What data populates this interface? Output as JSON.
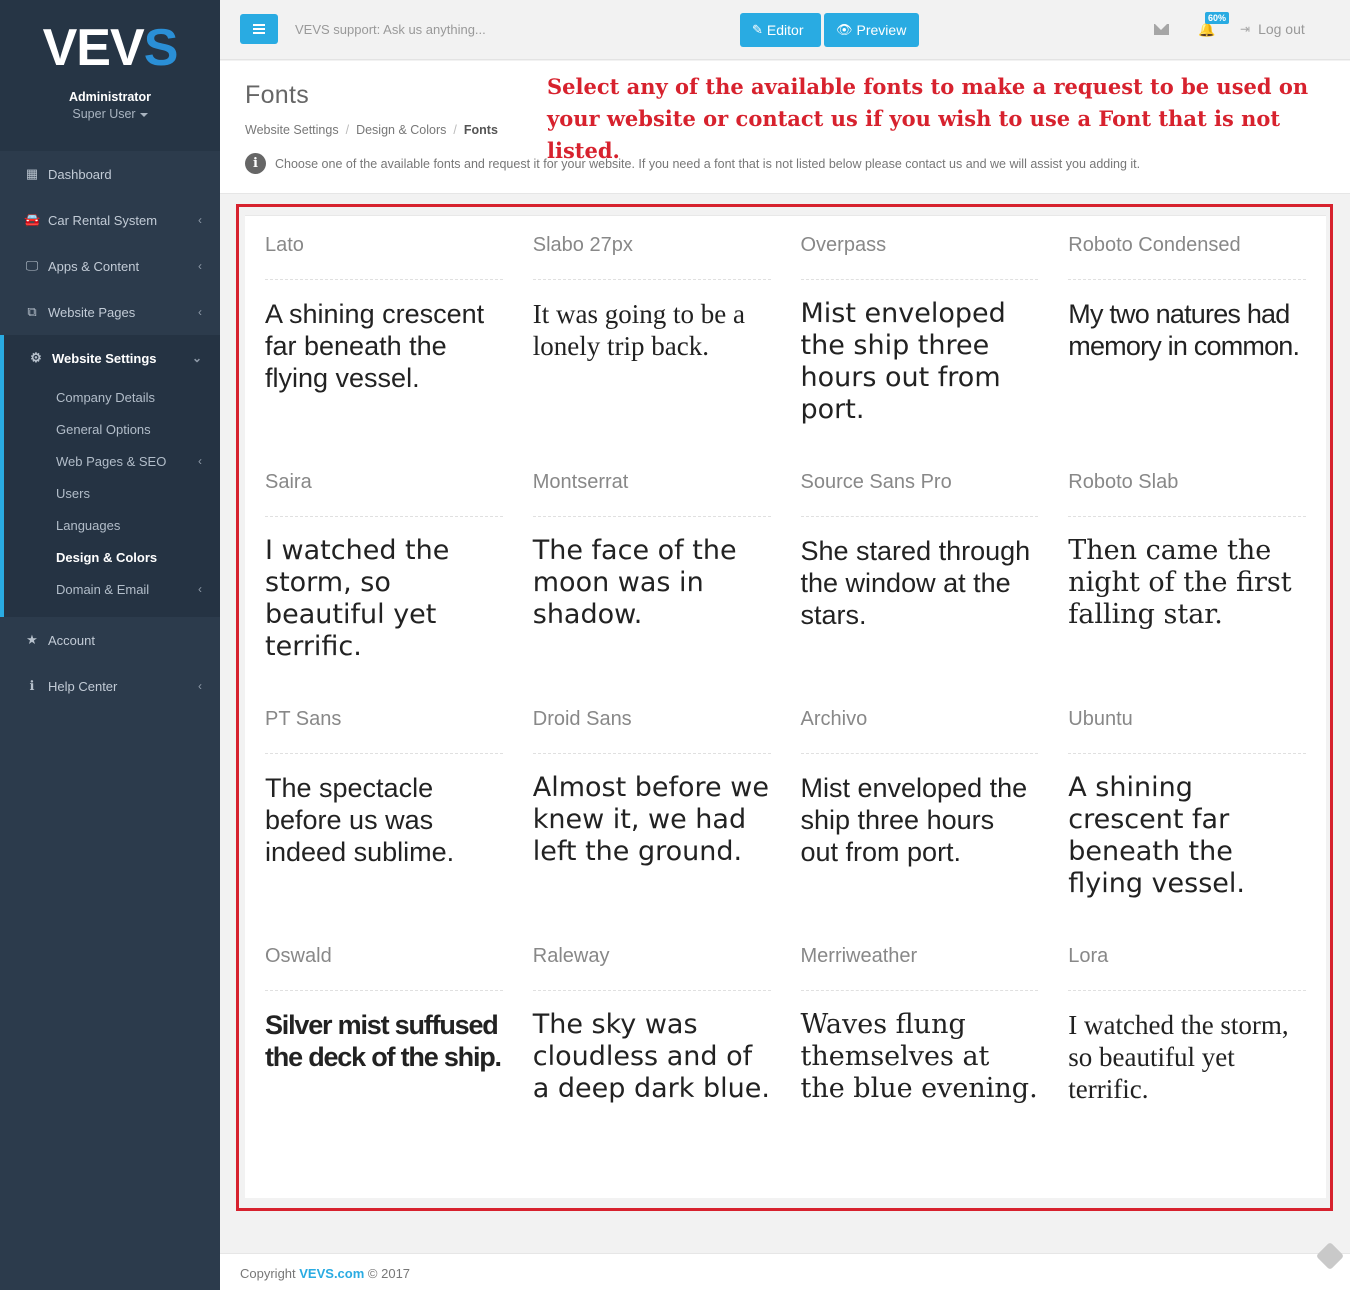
{
  "sidebar": {
    "logo_main": "VEV",
    "logo_accent": "S",
    "user_name": "Administrator",
    "user_role": "Super User",
    "items": [
      {
        "label": "Dashboard",
        "icon": "dashboard-icon",
        "glyph": "▦",
        "has_chevron": false
      },
      {
        "label": "Car Rental System",
        "icon": "car-icon",
        "glyph": "🚘",
        "has_chevron": true
      },
      {
        "label": "Apps & Content",
        "icon": "monitor-icon",
        "glyph": "🖵",
        "has_chevron": true
      },
      {
        "label": "Website Pages",
        "icon": "pages-icon",
        "glyph": "⧉",
        "has_chevron": true
      }
    ],
    "active": {
      "label": "Website Settings",
      "icon": "cogs-icon",
      "glyph": "⚙",
      "subitems": [
        {
          "label": "Company Details",
          "has_chevron": false
        },
        {
          "label": "General Options",
          "has_chevron": false
        },
        {
          "label": "Web Pages & SEO",
          "has_chevron": true
        },
        {
          "label": "Users",
          "has_chevron": false
        },
        {
          "label": "Languages",
          "has_chevron": false
        },
        {
          "label": "Design & Colors",
          "has_chevron": false,
          "current": true
        },
        {
          "label": "Domain & Email",
          "has_chevron": true
        }
      ]
    },
    "bottom_items": [
      {
        "label": "Account",
        "icon": "star-icon",
        "glyph": "★",
        "has_chevron": false
      },
      {
        "label": "Help Center",
        "icon": "info-icon",
        "glyph": "ℹ",
        "has_chevron": true
      }
    ],
    "chevron_glyph": "‹",
    "chevron_down_glyph": "⌄"
  },
  "topbar": {
    "support_text": "VEVS support: Ask us anything...",
    "editor_label": "Editor",
    "editor_glyph": "✎",
    "preview_label": "Preview",
    "preview_glyph": "👁",
    "badge": "60%",
    "logout_label": "Log out",
    "logout_glyph": "⇥",
    "bell_glyph": "🔔"
  },
  "header": {
    "title": "Fonts",
    "breadcrumb": [
      "Website Settings",
      "Design & Colors",
      "Fonts"
    ],
    "info_text": "Choose one of the available fonts and request it for your website. If you need a font that is not listed below please contact us and we will assist you adding it.",
    "info_glyph": "i",
    "annotation": "Select any of the available fonts to make a request to be used on your website or contact us if you wish to use a Font that is not listed."
  },
  "fonts": [
    {
      "name": "Lato",
      "sample": "A shining crescent far beneath the flying vessel.",
      "style": "f-sans"
    },
    {
      "name": "Slabo 27px",
      "sample": "It was going to be a lonely trip back.",
      "style": "f-serif"
    },
    {
      "name": "Overpass",
      "sample": "Mist enveloped the ship three hours out from port.",
      "style": "f-dejavu"
    },
    {
      "name": "Roboto Condensed",
      "sample": "My two natures had memory in common.",
      "style": "f-cond"
    },
    {
      "name": "Saira",
      "sample": "I watched the storm, so beautiful yet terrific.",
      "style": "f-dejavu"
    },
    {
      "name": "Montserrat",
      "sample": "The face of the moon was in shadow.",
      "style": "f-dejavu"
    },
    {
      "name": "Source Sans Pro",
      "sample": "She stared through the window at the stars.",
      "style": "f-sans"
    },
    {
      "name": "Roboto Slab",
      "sample": "Then came the night of the first falling star.",
      "style": "f-dserif"
    },
    {
      "name": "PT Sans",
      "sample": "The spectacle before us was indeed sublime.",
      "style": "f-sans"
    },
    {
      "name": "Droid Sans",
      "sample": "Almost before we knew it, we had left the ground.",
      "style": "f-dejavu"
    },
    {
      "name": "Archivo",
      "sample": "Mist enveloped the ship three hours out from port.",
      "style": "f-sans"
    },
    {
      "name": "Ubuntu",
      "sample": "A shining crescent far beneath the flying vessel.",
      "style": "f-dejavu"
    },
    {
      "name": "Oswald",
      "sample": "Silver mist suffused the deck of the ship.",
      "style": "f-oswald"
    },
    {
      "name": "Raleway",
      "sample": "The sky was cloudless and of a deep dark blue.",
      "style": "f-dejavu"
    },
    {
      "name": "Merriweather",
      "sample": "Waves flung themselves at the blue evening.",
      "style": "f-dserif"
    },
    {
      "name": "Lora",
      "sample": "I watched the storm, so beautiful yet terrific.",
      "style": "f-serif"
    }
  ],
  "footer": {
    "prefix": "Copyright",
    "brand": "VEVS.com",
    "suffix": "© 2017"
  },
  "colors": {
    "accent": "#29abe2",
    "sidebar": "#2c3b4c",
    "annotation": "#d7222e"
  }
}
